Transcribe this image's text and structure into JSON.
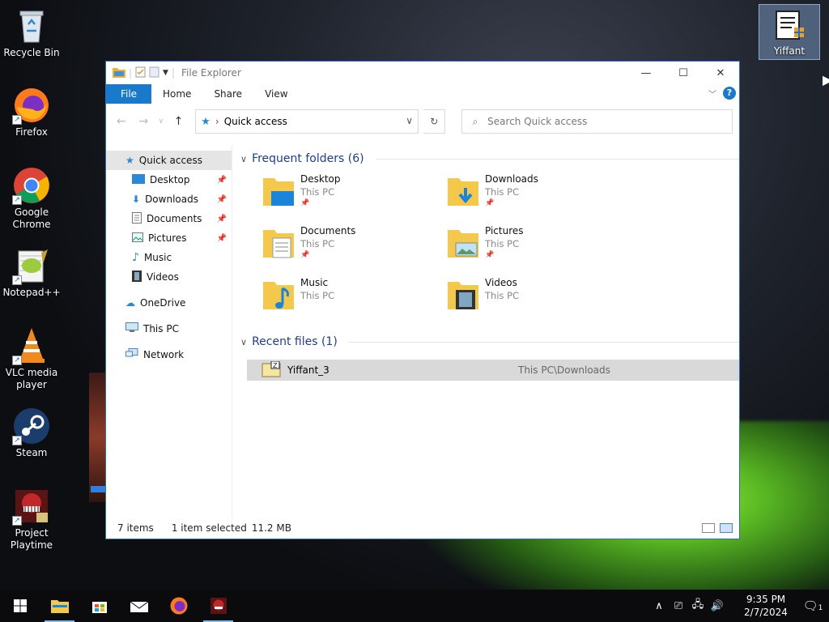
{
  "desktop": {
    "icons": [
      {
        "label": "Recycle Bin"
      },
      {
        "label": "Firefox"
      },
      {
        "label": "Google Chrome"
      },
      {
        "label": "Notepad++"
      },
      {
        "label": "VLC media player"
      },
      {
        "label": "Steam"
      },
      {
        "label": "Project Playtime"
      },
      {
        "label": "Yiffant"
      }
    ]
  },
  "window": {
    "title": "File Explorer",
    "tabs": [
      "File",
      "Home",
      "Share",
      "View"
    ],
    "address": "Quick access",
    "search_placeholder": "Search Quick access"
  },
  "navpane": {
    "quick_access": "Quick access",
    "pinned": [
      "Desktop",
      "Downloads",
      "Documents",
      "Pictures"
    ],
    "others": [
      "Music",
      "Videos"
    ],
    "onedrive": "OneDrive",
    "thispc": "This PC",
    "network": "Network"
  },
  "content": {
    "frequent_header": "Frequent folders (6)",
    "folders": [
      {
        "name": "Desktop",
        "location": "This PC",
        "pinned": true
      },
      {
        "name": "Downloads",
        "location": "This PC",
        "pinned": true
      },
      {
        "name": "Documents",
        "location": "This PC",
        "pinned": true
      },
      {
        "name": "Pictures",
        "location": "This PC",
        "pinned": true
      },
      {
        "name": "Music",
        "location": "This PC",
        "pinned": false
      },
      {
        "name": "Videos",
        "location": "This PC",
        "pinned": false
      }
    ],
    "recent_header": "Recent files (1)",
    "recent": [
      {
        "name": "Yiffant_3",
        "path": "This PC\\Downloads"
      }
    ]
  },
  "status": {
    "items": "7 items",
    "selected": "1 item selected",
    "size": "11.2 MB"
  },
  "taskbar": {
    "time": "9:35 PM",
    "date": "2/7/2024",
    "notification_count": "1"
  },
  "colors": {
    "accent": "#1979ca",
    "selection": "#d9d9d9",
    "section_header": "#1e3e8c"
  }
}
